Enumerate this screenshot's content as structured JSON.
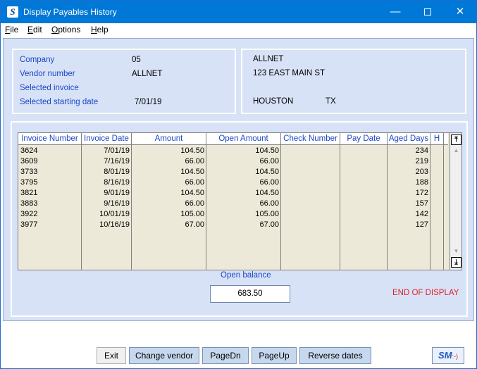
{
  "window": {
    "title": "Display Payables History",
    "app_icon": "S"
  },
  "titlebar_controls": {
    "minimize": "—",
    "maximize": "",
    "close": "✕"
  },
  "menu": [
    {
      "label": "File",
      "mnemonic": "F",
      "rest": "ile"
    },
    {
      "label": "Edit",
      "mnemonic": "E",
      "rest": "dit"
    },
    {
      "label": "Options",
      "mnemonic": "O",
      "rest": "ptions"
    },
    {
      "label": "Help",
      "mnemonic": "H",
      "rest": "elp"
    }
  ],
  "info": {
    "company_label": "Company",
    "company_value": "05",
    "vendor_label": "Vendor number",
    "vendor_value": "ALLNET",
    "selected_invoice_label": "Selected invoice",
    "selected_invoice_value": "",
    "starting_date_label": "Selected starting date",
    "starting_date_value": "7/01/19"
  },
  "address": {
    "name": "ALLNET",
    "street": "123 EAST MAIN ST",
    "city": "HOUSTON",
    "state": "TX"
  },
  "table": {
    "headers": [
      "Invoice Number",
      "Invoice Date",
      "Amount",
      "Open Amount",
      "Check Number",
      "Pay Date",
      "Aged Days",
      "H"
    ],
    "rows": [
      [
        "3624",
        "7/01/19",
        "104.50",
        "104.50",
        "",
        "",
        "234",
        ""
      ],
      [
        "3609",
        "7/16/19",
        "66.00",
        "66.00",
        "",
        "",
        "219",
        ""
      ],
      [
        "3733",
        "8/01/19",
        "104.50",
        "104.50",
        "",
        "",
        "203",
        ""
      ],
      [
        "3795",
        "8/16/19",
        "66.00",
        "66.00",
        "",
        "",
        "188",
        ""
      ],
      [
        "3821",
        "9/01/19",
        "104.50",
        "104.50",
        "",
        "",
        "172",
        ""
      ],
      [
        "3883",
        "9/16/19",
        "66.00",
        "66.00",
        "",
        "",
        "157",
        ""
      ],
      [
        "3922",
        "10/01/19",
        "105.00",
        "105.00",
        "",
        "",
        "142",
        ""
      ],
      [
        "3977",
        "10/16/19",
        "67.00",
        "67.00",
        "",
        "",
        "127",
        ""
      ]
    ]
  },
  "open_balance": {
    "label": "Open balance",
    "value": "683.50"
  },
  "status": "END OF DISPLAY",
  "buttons": {
    "exit": "Exit",
    "change_vendor": "Change vendor",
    "page_dn": "PageDn",
    "page_up": "PageUp",
    "reverse_dates": "Reverse dates"
  },
  "logo": {
    "text": "SM",
    "face": ":-)"
  },
  "colors": {
    "titlebar": "#0078d7",
    "label_blue": "#1c47c9",
    "status_red": "#e0202a",
    "panel_bg": "#d7e2f6"
  }
}
